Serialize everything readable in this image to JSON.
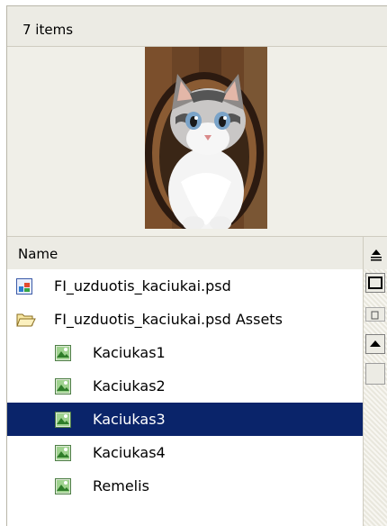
{
  "panel": {
    "item_count": "7 items"
  },
  "list_header": {
    "name_label": "Name"
  },
  "items": [
    {
      "label": "FI_uzduotis_kaciukai.psd",
      "icon": "psd-file-icon",
      "indent": 0,
      "selected": false
    },
    {
      "label": "FI_uzduotis_kaciukai.psd Assets",
      "icon": "folder-open-icon",
      "indent": 0,
      "selected": false
    },
    {
      "label": "Kaciukas1",
      "icon": "image-asset-icon",
      "indent": 1,
      "selected": false
    },
    {
      "label": "Kaciukas2",
      "icon": "image-asset-icon",
      "indent": 1,
      "selected": false
    },
    {
      "label": "Kaciukas3",
      "icon": "image-asset-icon",
      "indent": 1,
      "selected": true
    },
    {
      "label": "Kaciukas4",
      "icon": "image-asset-icon",
      "indent": 1,
      "selected": false
    },
    {
      "label": "Remelis",
      "icon": "image-asset-icon",
      "indent": 1,
      "selected": false
    }
  ],
  "colors": {
    "selection": "#0a246a",
    "panel_bg": "#f0efe8"
  }
}
